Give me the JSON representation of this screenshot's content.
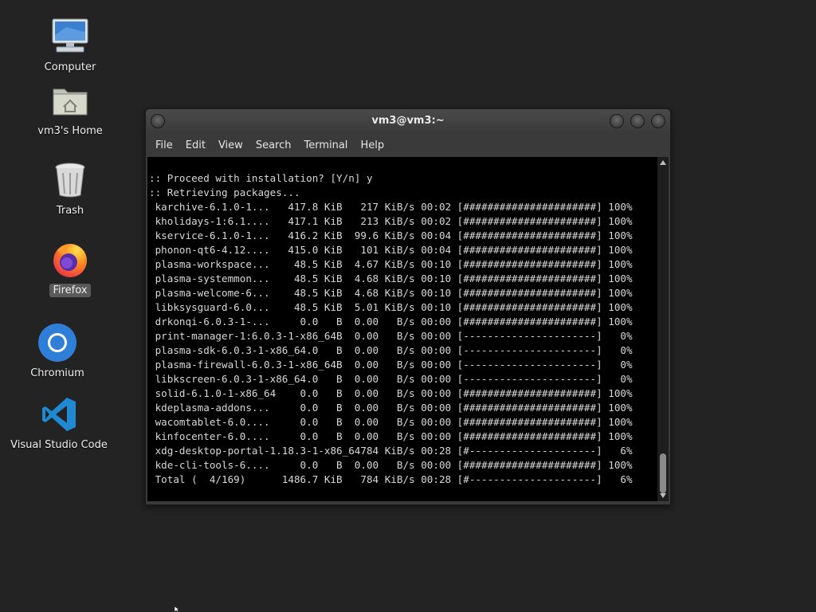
{
  "desktop": {
    "icons": [
      {
        "label": "Computer",
        "icon": "computer-icon"
      },
      {
        "label": "vm3's Home",
        "icon": "home-folder-icon"
      },
      {
        "label": "Trash",
        "icon": "trash-icon"
      },
      {
        "label": "Firefox",
        "icon": "firefox-icon",
        "selected": true
      },
      {
        "label": "Chromium",
        "icon": "chromium-icon"
      },
      {
        "label": "Visual Studio Code",
        "icon": "vscode-icon"
      }
    ]
  },
  "window": {
    "title": "vm3@vm3:~",
    "menu": [
      "File",
      "Edit",
      "View",
      "Search",
      "Terminal",
      "Help"
    ]
  },
  "terminal": {
    "lines": [
      ":: Proceed with installation? [Y/n] y",
      ":: Retrieving packages...",
      " karchive-6.1.0-1...   417.8 KiB   217 KiB/s 00:02 [######################] 100%",
      " kholidays-1:6.1....   417.1 KiB   213 KiB/s 00:02 [######################] 100%",
      " kservice-6.1.0-1...   416.2 KiB  99.6 KiB/s 00:04 [######################] 100%",
      " phonon-qt6-4.12....   415.0 KiB   101 KiB/s 00:04 [######################] 100%",
      " plasma-workspace...    48.5 KiB  4.67 KiB/s 00:10 [######################] 100%",
      " plasma-systemmon...    48.5 KiB  4.68 KiB/s 00:10 [######################] 100%",
      " plasma-welcome-6...    48.5 KiB  4.68 KiB/s 00:10 [######################] 100%",
      " libksysguard-6.0...    48.5 KiB  5.01 KiB/s 00:10 [######################] 100%",
      " drkonqi-6.0.3-1-...     0.0   B  0.00   B/s 00:00 [######################] 100%",
      " print-manager-1:6.0.3-1-x86_64B  0.00   B/s 00:00 [----------------------]   0%",
      " plasma-sdk-6.0.3-1-x86_64.0   B  0.00   B/s 00:00 [----------------------]   0%",
      " plasma-firewall-6.0.3-1-x86_64B  0.00   B/s 00:00 [----------------------]   0%",
      " libkscreen-6.0.3-1-x86_64.0   B  0.00   B/s 00:00 [----------------------]   0%",
      " solid-6.1.0-1-x86_64    0.0   B  0.00   B/s 00:00 [######################] 100%",
      " kdeplasma-addons...     0.0   B  0.00   B/s 00:00 [######################] 100%",
      " wacomtablet-6.0....     0.0   B  0.00   B/s 00:00 [######################] 100%",
      " kinfocenter-6.0....     0.0   B  0.00   B/s 00:00 [######################] 100%",
      " xdg-desktop-portal-1.18.3-1-x86_64784 KiB/s 00:28 [#---------------------]   6%",
      " kde-cli-tools-6....     0.0   B  0.00   B/s 00:00 [######################] 100%",
      " Total (  4/169)      1486.7 KiB   784 KiB/s 00:28 [#---------------------]   6%"
    ]
  },
  "colors": {
    "desktop_bg": "#232323",
    "terminal_bg": "#000000",
    "terminal_fg": "#d8d8d8",
    "titlebar": "#3a3a3a"
  }
}
